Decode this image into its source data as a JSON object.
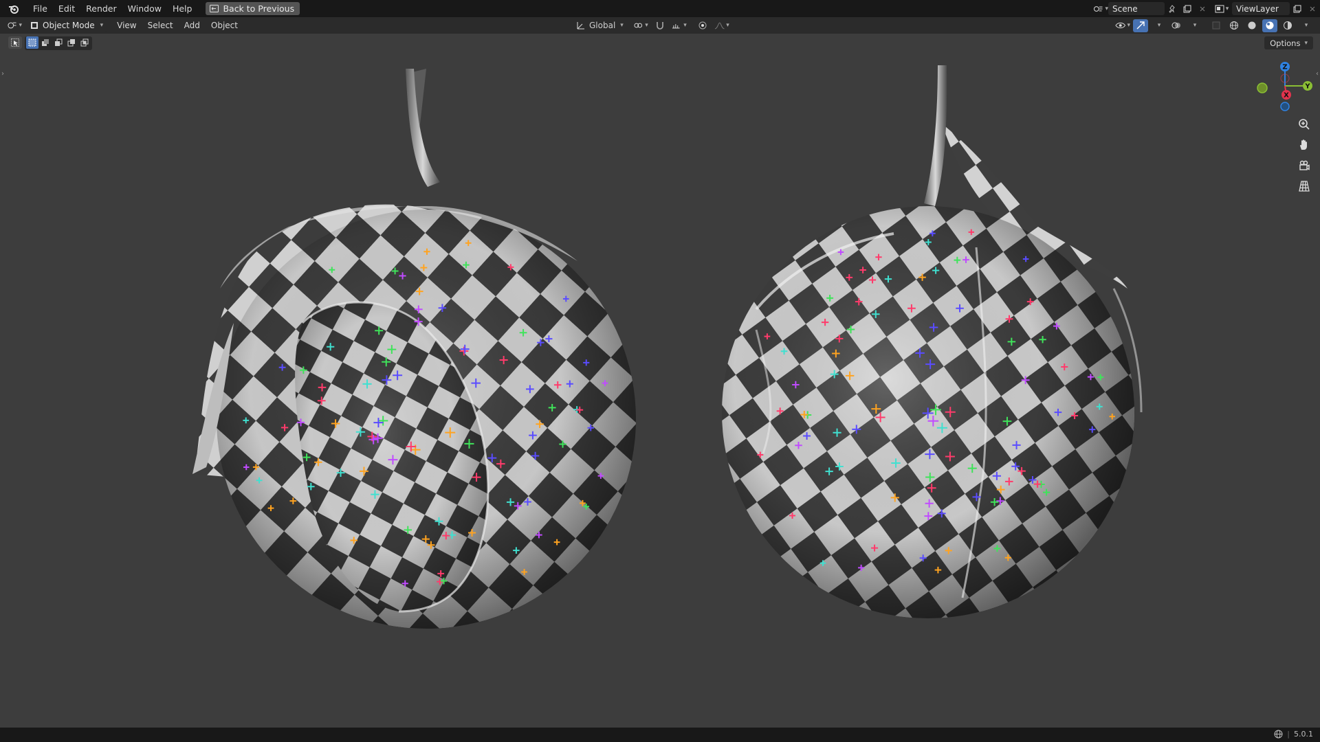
{
  "menu": {
    "items": [
      "File",
      "Edit",
      "Render",
      "Window",
      "Help"
    ],
    "back_label": "Back to Previous"
  },
  "topbar_right": {
    "scene_name": "Scene",
    "view_layer_name": "ViewLayer"
  },
  "header": {
    "mode_label": "Object Mode",
    "menus": [
      "View",
      "Select",
      "Add",
      "Object"
    ],
    "orientation_label": "Global",
    "options_label": "Options"
  },
  "gizmo": {
    "axes": {
      "x": "X",
      "y": "Y",
      "z": "Z"
    },
    "colors": {
      "x": "#e2334d",
      "y": "#8bbf34",
      "z": "#2f83e3"
    }
  },
  "viewport": {
    "background": "#3d3d3d",
    "checker_dark": "#3e3e3e",
    "checker_light": "#d2d2d2",
    "marker_colors": [
      "#ff3b6b",
      "#3fe35a",
      "#5a4cff",
      "#ffa320",
      "#40e0d0",
      "#c04bff"
    ]
  },
  "status": {
    "version": "5.0.1"
  }
}
